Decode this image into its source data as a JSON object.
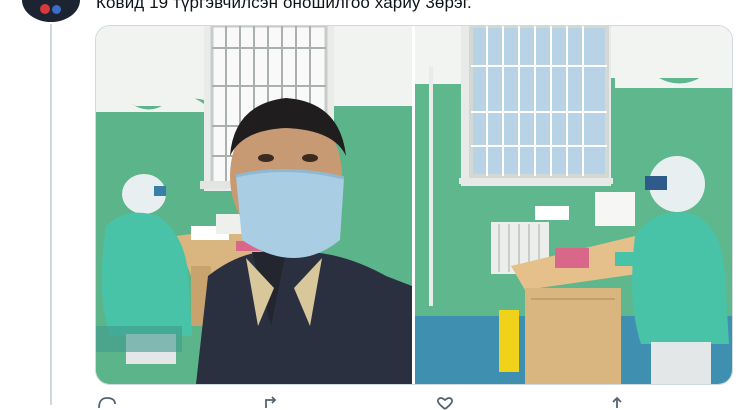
{
  "tweet": {
    "text": "Ковид 19 түргэвчилсэн оношилгоо хариу 3өрэг."
  },
  "media": {
    "photos": [
      {
        "subject": "selfie with medical worker in protective suit"
      },
      {
        "subject": "medical worker in protective suit at desk"
      }
    ]
  },
  "icons": {
    "reply": "reply-icon",
    "retweet": "retweet-icon",
    "like": "heart-icon",
    "share": "share-icon"
  },
  "colors": {
    "wall_green": "#5fb88d",
    "wall_white": "#f2f4f1",
    "ppe_green": "#49c3a8",
    "desk_tan": "#d9b57f"
  }
}
